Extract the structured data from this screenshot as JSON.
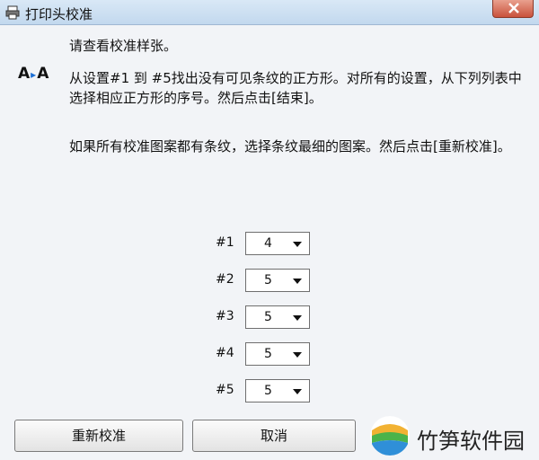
{
  "window": {
    "title": "打印头校准"
  },
  "icons": {
    "title": "printer-icon",
    "aa": "a-to-a-icon",
    "close": "close-icon",
    "brand": "brand-logo-icon"
  },
  "aa_icon": {
    "left": "A",
    "arrow": "▸",
    "right": "A"
  },
  "instructions": {
    "line1": "请查看校准样张。",
    "line2": "从设置#1 到 #5找出没有可见条纹的正方形。对所有的设置，从下列列表中选择相应正方形的序号。然后点击[结束]。",
    "line3": "如果所有校准图案都有条纹，选择条纹最细的图案。然后点击[重新校准]。"
  },
  "settings": [
    {
      "label": "#1",
      "value": "4"
    },
    {
      "label": "#2",
      "value": "5"
    },
    {
      "label": "#3",
      "value": "5"
    },
    {
      "label": "#4",
      "value": "5"
    },
    {
      "label": "#5",
      "value": "5"
    }
  ],
  "buttons": {
    "recalibrate": "重新校准",
    "cancel": "取消"
  },
  "brand": {
    "name": "竹笋软件园"
  },
  "colors": {
    "accent": "#1c6fd6",
    "close": "#c9523c"
  }
}
